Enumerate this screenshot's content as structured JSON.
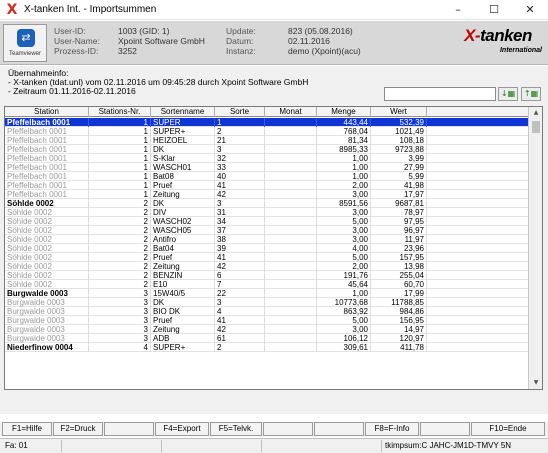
{
  "window": {
    "title": "X-tanken Int. - Importsummen",
    "minimize": "–",
    "maximize": "☐",
    "close": "✕",
    "icon": "x-logo-icon"
  },
  "info": {
    "user_id_label": "User-ID:",
    "user_id": "1003 (GID: 1)",
    "user_name_label": "User-Name:",
    "user_name": "Xpoint Software GmbH",
    "process_id_label": "Prozess-ID:",
    "process_id": "3252",
    "update_label": "Update:",
    "update": "823 (05.08.2016)",
    "date_label": "Datum:",
    "date": "02.11.2016",
    "instance_label": "Instanz:",
    "instance": "demo (Xpoint)(acu)",
    "teamviewer_label": "Teamviewer"
  },
  "logo": {
    "main_prefix": "X-",
    "main_rest": "tanken",
    "sub": "International"
  },
  "import": {
    "heading": "Übernahmeinfo:",
    "line1": "- X-tanken (tdat.unl) vom 02.11.2016 um 09:45:28 durch Xpoint Software GmbH",
    "line2": "- Zeitraum 01.11.2016-02.11.2016"
  },
  "search": {
    "value": ""
  },
  "columns": [
    "Station",
    "Stations-Nr.",
    "Sortenname",
    "Sorte",
    "Monat",
    "Menge",
    "Wert"
  ],
  "rows": [
    {
      "station": "Pfeffelbach 0001",
      "nr": "1",
      "name": "SUPER",
      "sorte": "1",
      "monat": "",
      "menge": "443,44",
      "wert": "532,39",
      "first": true,
      "selected": true
    },
    {
      "station": "Pfeffelbach 0001",
      "nr": "1",
      "name": "SUPER+",
      "sorte": "2",
      "monat": "",
      "menge": "768,04",
      "wert": "1021,49"
    },
    {
      "station": "Pfeffelbach 0001",
      "nr": "1",
      "name": "HEIZOEL",
      "sorte": "21",
      "monat": "",
      "menge": "81,34",
      "wert": "108,18"
    },
    {
      "station": "Pfeffelbach 0001",
      "nr": "1",
      "name": "DK",
      "sorte": "3",
      "monat": "",
      "menge": "8985,33",
      "wert": "9723,88"
    },
    {
      "station": "Pfeffelbach 0001",
      "nr": "1",
      "name": "S-Klar",
      "sorte": "32",
      "monat": "",
      "menge": "1,00",
      "wert": "3,99"
    },
    {
      "station": "Pfeffelbach 0001",
      "nr": "1",
      "name": "WASCH01",
      "sorte": "33",
      "monat": "",
      "menge": "1,00",
      "wert": "27,99"
    },
    {
      "station": "Pfeffelbach 0001",
      "nr": "1",
      "name": "Bat08",
      "sorte": "40",
      "monat": "",
      "menge": "1,00",
      "wert": "5,99"
    },
    {
      "station": "Pfeffelbach 0001",
      "nr": "1",
      "name": "Pruef",
      "sorte": "41",
      "monat": "",
      "menge": "2,00",
      "wert": "41,98"
    },
    {
      "station": "Pfeffelbach 0001",
      "nr": "1",
      "name": "Zeitung",
      "sorte": "42",
      "monat": "",
      "menge": "3,00",
      "wert": "17,97"
    },
    {
      "station": "Söhlde 0002",
      "nr": "2",
      "name": "DK",
      "sorte": "3",
      "monat": "",
      "menge": "8591,56",
      "wert": "9687,81",
      "first": true
    },
    {
      "station": "Söhlde 0002",
      "nr": "2",
      "name": "DIV",
      "sorte": "31",
      "monat": "",
      "menge": "3,00",
      "wert": "78,97"
    },
    {
      "station": "Söhlde 0002",
      "nr": "2",
      "name": "WASCH02",
      "sorte": "34",
      "monat": "",
      "menge": "5,00",
      "wert": "97,95"
    },
    {
      "station": "Söhlde 0002",
      "nr": "2",
      "name": "WASCH05",
      "sorte": "37",
      "monat": "",
      "menge": "3,00",
      "wert": "96,97"
    },
    {
      "station": "Söhlde 0002",
      "nr": "2",
      "name": "Antifro",
      "sorte": "38",
      "monat": "",
      "menge": "3,00",
      "wert": "11,97"
    },
    {
      "station": "Söhlde 0002",
      "nr": "2",
      "name": "Bat04",
      "sorte": "39",
      "monat": "",
      "menge": "4,00",
      "wert": "23,96"
    },
    {
      "station": "Söhlde 0002",
      "nr": "2",
      "name": "Pruef",
      "sorte": "41",
      "monat": "",
      "menge": "5,00",
      "wert": "157,95"
    },
    {
      "station": "Söhlde 0002",
      "nr": "2",
      "name": "Zeitung",
      "sorte": "42",
      "monat": "",
      "menge": "2,00",
      "wert": "13,98"
    },
    {
      "station": "Söhlde 0002",
      "nr": "2",
      "name": "BENZIN",
      "sorte": "6",
      "monat": "",
      "menge": "191,76",
      "wert": "255,04"
    },
    {
      "station": "Söhlde 0002",
      "nr": "2",
      "name": "E10",
      "sorte": "7",
      "monat": "",
      "menge": "45,64",
      "wert": "60,70"
    },
    {
      "station": "Burgwalde 0003",
      "nr": "3",
      "name": "15W40/5",
      "sorte": "22",
      "monat": "",
      "menge": "1,00",
      "wert": "17,99",
      "first": true
    },
    {
      "station": "Burgwalde 0003",
      "nr": "3",
      "name": "DK",
      "sorte": "3",
      "monat": "",
      "menge": "10773,68",
      "wert": "11788,85"
    },
    {
      "station": "Burgwalde 0003",
      "nr": "3",
      "name": "BIO DK",
      "sorte": "4",
      "monat": "",
      "menge": "863,92",
      "wert": "984,86"
    },
    {
      "station": "Burgwalde 0003",
      "nr": "3",
      "name": "Pruef",
      "sorte": "41",
      "monat": "",
      "menge": "5,00",
      "wert": "156,95"
    },
    {
      "station": "Burgwalde 0003",
      "nr": "3",
      "name": "Zeitung",
      "sorte": "42",
      "monat": "",
      "menge": "3,00",
      "wert": "14,97"
    },
    {
      "station": "Burgwalde 0003",
      "nr": "3",
      "name": "ADB",
      "sorte": "61",
      "monat": "",
      "menge": "106,12",
      "wert": "120,97"
    },
    {
      "station": "Niederfinow 0004",
      "nr": "4",
      "name": "SUPER+",
      "sorte": "2",
      "monat": "",
      "menge": "309,61",
      "wert": "411,78",
      "first": true
    }
  ],
  "fkeys": {
    "f1": "F1=Hilfe",
    "f2": "F2=Druck",
    "f4": "F4=Export",
    "f5": "F5=Telvk.",
    "f8": "F8=F-Info",
    "f10": "F10=Ende"
  },
  "status": {
    "left": "Fa: 01",
    "right": "tkimpsum:C JAHC-JM1D-TMVY 5N"
  },
  "colors": {
    "selection": "#0f35d4",
    "logo_red": "#c40000",
    "dim_text": "#9a9a9a"
  }
}
